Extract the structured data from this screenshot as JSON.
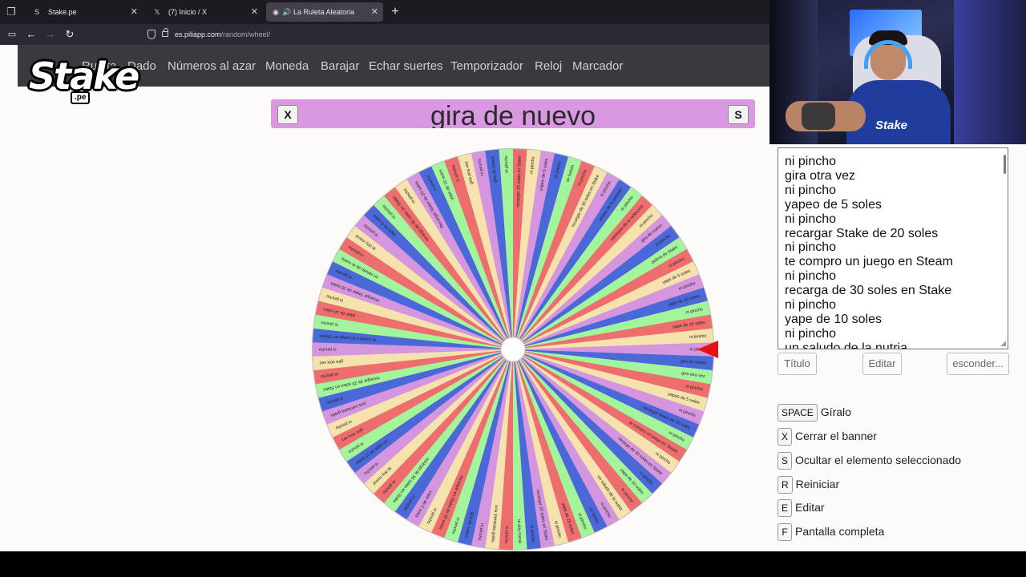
{
  "browser": {
    "tabs": [
      {
        "title": "Stake.pe",
        "favicon": "S",
        "active": false
      },
      {
        "title": "(7) Inicio / X",
        "favicon": "𝕏",
        "active": false
      },
      {
        "title": "La Ruleta Aleatoria",
        "favicon": "◉",
        "active": true
      }
    ],
    "url_domain": "es.piliapp.com",
    "url_path": "/random/wheel/"
  },
  "site_nav": [
    "Ruleta",
    "Dado",
    "Números al azar",
    "Moneda",
    "Barajar",
    "Echar suertes",
    "Temporizador",
    "Reloj",
    "Marcador"
  ],
  "overlay_logo": {
    "word": "Stake",
    "suffix": ".pe"
  },
  "banner": {
    "close_key": "X",
    "text": "gira de nuevo",
    "hide_key": "S",
    "color": "#d998e1"
  },
  "wheel": {
    "colors": [
      "#d596df",
      "#4a68d8",
      "#a3f59b",
      "#ee6d6d",
      "#f6e2ad"
    ],
    "pointer_color": "#e81010",
    "slice_labels": [
      "ni pincho",
      "gira de nuevo",
      "gira otra vez",
      "ni pincho",
      "yapeo de 5 soles",
      "ni pincho",
      "recargar Stake de 20 soles",
      "ni pincho",
      "te compro un juego en Steam",
      "ni pincho",
      "recarga de 30 soles en Stake",
      "ni pincho",
      "yape de 10 soles",
      "ni pincho",
      "un saludo de la nutria",
      "ni pincho",
      "un fumón",
      "ni pincho",
      "yape de 15 soles",
      "ni pincho",
      "recargar 20 soles en Stake",
      "ni pincho",
      "te doy moral",
      "ni pincho",
      "una camiseta gratis",
      "ni pincho",
      "gira de nuevo",
      "ni pincho",
      "recargar en Stake de 20 soles",
      "ni pincho",
      "yape de 5 soles",
      "ni pincho",
      "recarga de 30 soles en Stake",
      "ni pincho",
      "te doy moral",
      "ni pincho",
      "un yape de 15 soles",
      "ni pincho",
      "gira otra vez",
      "ni pincho",
      "una camiseta gratis",
      "ni pincho",
      "recargar de 20 soles en Stake",
      "ni pincho",
      "gira otra vez",
      "ni pincho",
      "te compro un juego en Steam",
      "ni pincho",
      "yape de 10 soles",
      "ni pincho",
      "recargar Stake de 20 soles",
      "ni pincho",
      "un saludo de la nutria",
      "ni pincho",
      "te doy moral",
      "ni pincho",
      "yape de 5 soles",
      "ni pincho",
      "recarga de 30 soles en Stake",
      "ni pincho",
      "Recargar Stake de 20 soles",
      "ni pincho",
      "yape de 10 soles",
      "ni pincho",
      "gira otra vez",
      "ni pincho",
      "gira de nuevo",
      "ni pincho",
      "recargar 20 soles en Stake",
      "ni pincho",
      "yapeo de 5 soles",
      "ni pincho",
      "un fumón",
      "ni pincho",
      "recargar de 30 soles en Stake",
      "ni pincho",
      "pelota de la premier",
      "ni pincho",
      "camiseta de la seleccion",
      "ni pincho",
      "gira de nuevo",
      "ni pincho",
      "polera de Stake",
      "ni pincho",
      "yape de 5 soles",
      "ni pincho",
      "yape de 30 soles",
      "ni pincho",
      "yape de 10 soles",
      "ni pincho"
    ]
  },
  "webcam": {
    "shirt_text": "Stake"
  },
  "editor": {
    "lines": [
      "ni pincho",
      "gira otra vez",
      "ni pincho",
      "yapeo de 5 soles",
      "ni pincho",
      "recargar Stake de 20 soles",
      "ni pincho",
      "te compro un juego en Steam",
      "ni pincho",
      "recarga de 30 soles en Stake",
      "ni pincho",
      "yape de 10 soles",
      "ni pincho",
      "un saludo de la nutria"
    ]
  },
  "buttons": {
    "title": "Título",
    "edit": "Editar",
    "hide": "esconder..."
  },
  "shortcuts": [
    {
      "key": "SPACE",
      "label": "Gíralo"
    },
    {
      "key": "X",
      "label": "Cerrar el banner"
    },
    {
      "key": "S",
      "label": "Ocultar el elemento seleccionado"
    },
    {
      "key": "R",
      "label": "Reiniciar"
    },
    {
      "key": "E",
      "label": "Editar"
    },
    {
      "key": "F",
      "label": "Pantalla completa"
    }
  ]
}
